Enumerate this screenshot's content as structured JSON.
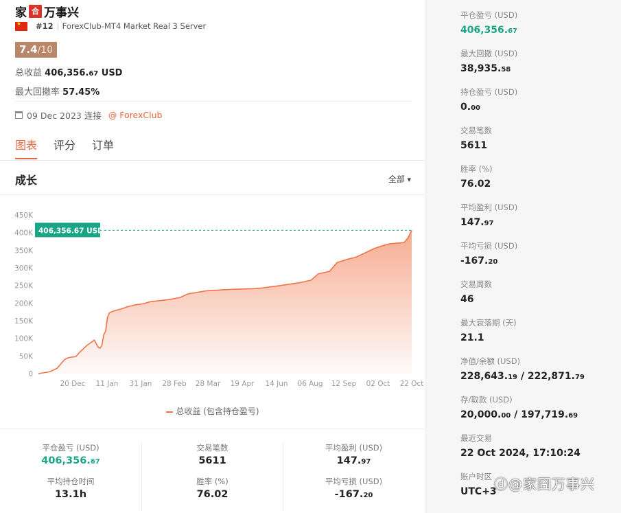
{
  "header": {
    "title_prefix": "家",
    "title_badge": "合",
    "title_suffix": "万事兴",
    "rank": "#12",
    "server": "ForexClub-MT4 Market Real 3 Server",
    "score": "7.4",
    "score_max": "/10",
    "total_profit_label": "总收益",
    "total_profit_int": "406,356.",
    "total_profit_dec": "67",
    "total_profit_unit": " USD",
    "drawdown_label": "最大回撤率",
    "drawdown_value": "57.45%",
    "connected": "09 Dec 2023 连接",
    "broker": "@ ForexClub",
    "colors": {
      "accent": "#e4683f",
      "green": "#1aa587",
      "score_bg": "#b8876a"
    }
  },
  "tabs": [
    {
      "label": "图表",
      "active": true
    },
    {
      "label": "评分",
      "active": false
    },
    {
      "label": "订单",
      "active": false
    }
  ],
  "chart_section": {
    "title": "成长",
    "range": "全部",
    "legend": "总收益 (包含持仓盈亏)",
    "marker_label": "406,356.67 USD"
  },
  "chart_data": {
    "type": "area",
    "y_ticks": [
      "0",
      "50K",
      "100K",
      "150K",
      "200K",
      "250K",
      "300K",
      "350K",
      "400K",
      "450K"
    ],
    "x_ticks": [
      "20 Dec",
      "11 Jan",
      "31 Jan",
      "28 Feb",
      "28 Mar",
      "19 Apr",
      "14 Jun",
      "06 Aug",
      "12 Sep",
      "02 Oct",
      "22 Oct"
    ],
    "ylim": [
      0,
      450000
    ],
    "x": [
      0,
      0.03,
      0.05,
      0.07,
      0.08,
      0.09,
      0.1,
      0.11,
      0.13,
      0.15,
      0.16,
      0.165,
      0.17,
      0.175,
      0.18,
      0.185,
      0.19,
      0.195,
      0.2,
      0.21,
      0.22,
      0.24,
      0.26,
      0.28,
      0.3,
      0.35,
      0.38,
      0.4,
      0.45,
      0.5,
      0.52,
      0.55,
      0.58,
      0.6,
      0.65,
      0.7,
      0.73,
      0.75,
      0.78,
      0.8,
      0.83,
      0.85,
      0.87,
      0.9,
      0.92,
      0.94,
      0.96,
      0.98,
      0.99,
      1.0
    ],
    "values": [
      0,
      5000,
      15000,
      40000,
      45000,
      47000,
      48000,
      60000,
      80000,
      95000,
      75000,
      72000,
      80000,
      110000,
      120000,
      160000,
      172000,
      175000,
      177000,
      180000,
      183000,
      190000,
      195000,
      198000,
      204000,
      210000,
      216000,
      226000,
      235000,
      238000,
      239000,
      240000,
      241000,
      243000,
      250000,
      258000,
      265000,
      283000,
      290000,
      315000,
      325000,
      330000,
      340000,
      355000,
      362000,
      368000,
      370000,
      372000,
      385000,
      406356.67
    ],
    "marker_value": 406356.67,
    "grid": false
  },
  "bottom_stats": [
    {
      "label": "平仓盈亏 (USD)",
      "int": "406,356.",
      "dec": "67",
      "green": true
    },
    {
      "label": "交易笔数",
      "int": "5611",
      "dec": "",
      "green": false
    },
    {
      "label": "平均盈利 (USD)",
      "int": "147.",
      "dec": "97",
      "green": false
    },
    {
      "label": "平均持仓时间",
      "int": "13.1h",
      "dec": "",
      "green": false
    },
    {
      "label": "胜率 (%)",
      "int": "76.02",
      "dec": "",
      "green": false
    },
    {
      "label": "平均亏损 (USD)",
      "int": "-167.",
      "dec": "20",
      "green": false
    }
  ],
  "sidebar": [
    {
      "label": "平仓盈亏 (USD)",
      "int": "406,356.",
      "dec": "67",
      "green": true
    },
    {
      "label": "最大回撤 (USD)",
      "int": "38,935.",
      "dec": "58",
      "green": false
    },
    {
      "label": "持仓盈亏 (USD)",
      "int": "0.",
      "dec": "00",
      "green": false
    },
    {
      "label": "交易笔数",
      "int": "5611",
      "dec": "",
      "green": false
    },
    {
      "label": "胜率 (%)",
      "int": "76.02",
      "dec": "",
      "green": false
    },
    {
      "label": "平均盈利 (USD)",
      "int": "147.",
      "dec": "97",
      "green": false
    },
    {
      "label": "平均亏损 (USD)",
      "int": "-167.",
      "dec": "20",
      "green": false
    },
    {
      "label": "交易周数",
      "int": "46",
      "dec": "",
      "green": false
    },
    {
      "label": "最大衰落期 (天)",
      "int": "21.1",
      "dec": "",
      "green": false
    },
    {
      "label": "净值/余额 (USD)",
      "int": "228,643.",
      "dec": "19",
      "int2": " / 222,871.",
      "dec2": "79",
      "green": false
    },
    {
      "label": "存/取款 (USD)",
      "int": "20,000.",
      "dec": "00",
      "int2": " / 197,719.",
      "dec2": "69",
      "green": false
    },
    {
      "label": "最近交易",
      "int": "22 Oct 2024, 17:10:24",
      "dec": "",
      "green": false
    },
    {
      "label": "账户时区",
      "int": "UTC+3",
      "dec": "",
      "green": false
    }
  ],
  "watermark": "ⓓ@家囧万事兴"
}
